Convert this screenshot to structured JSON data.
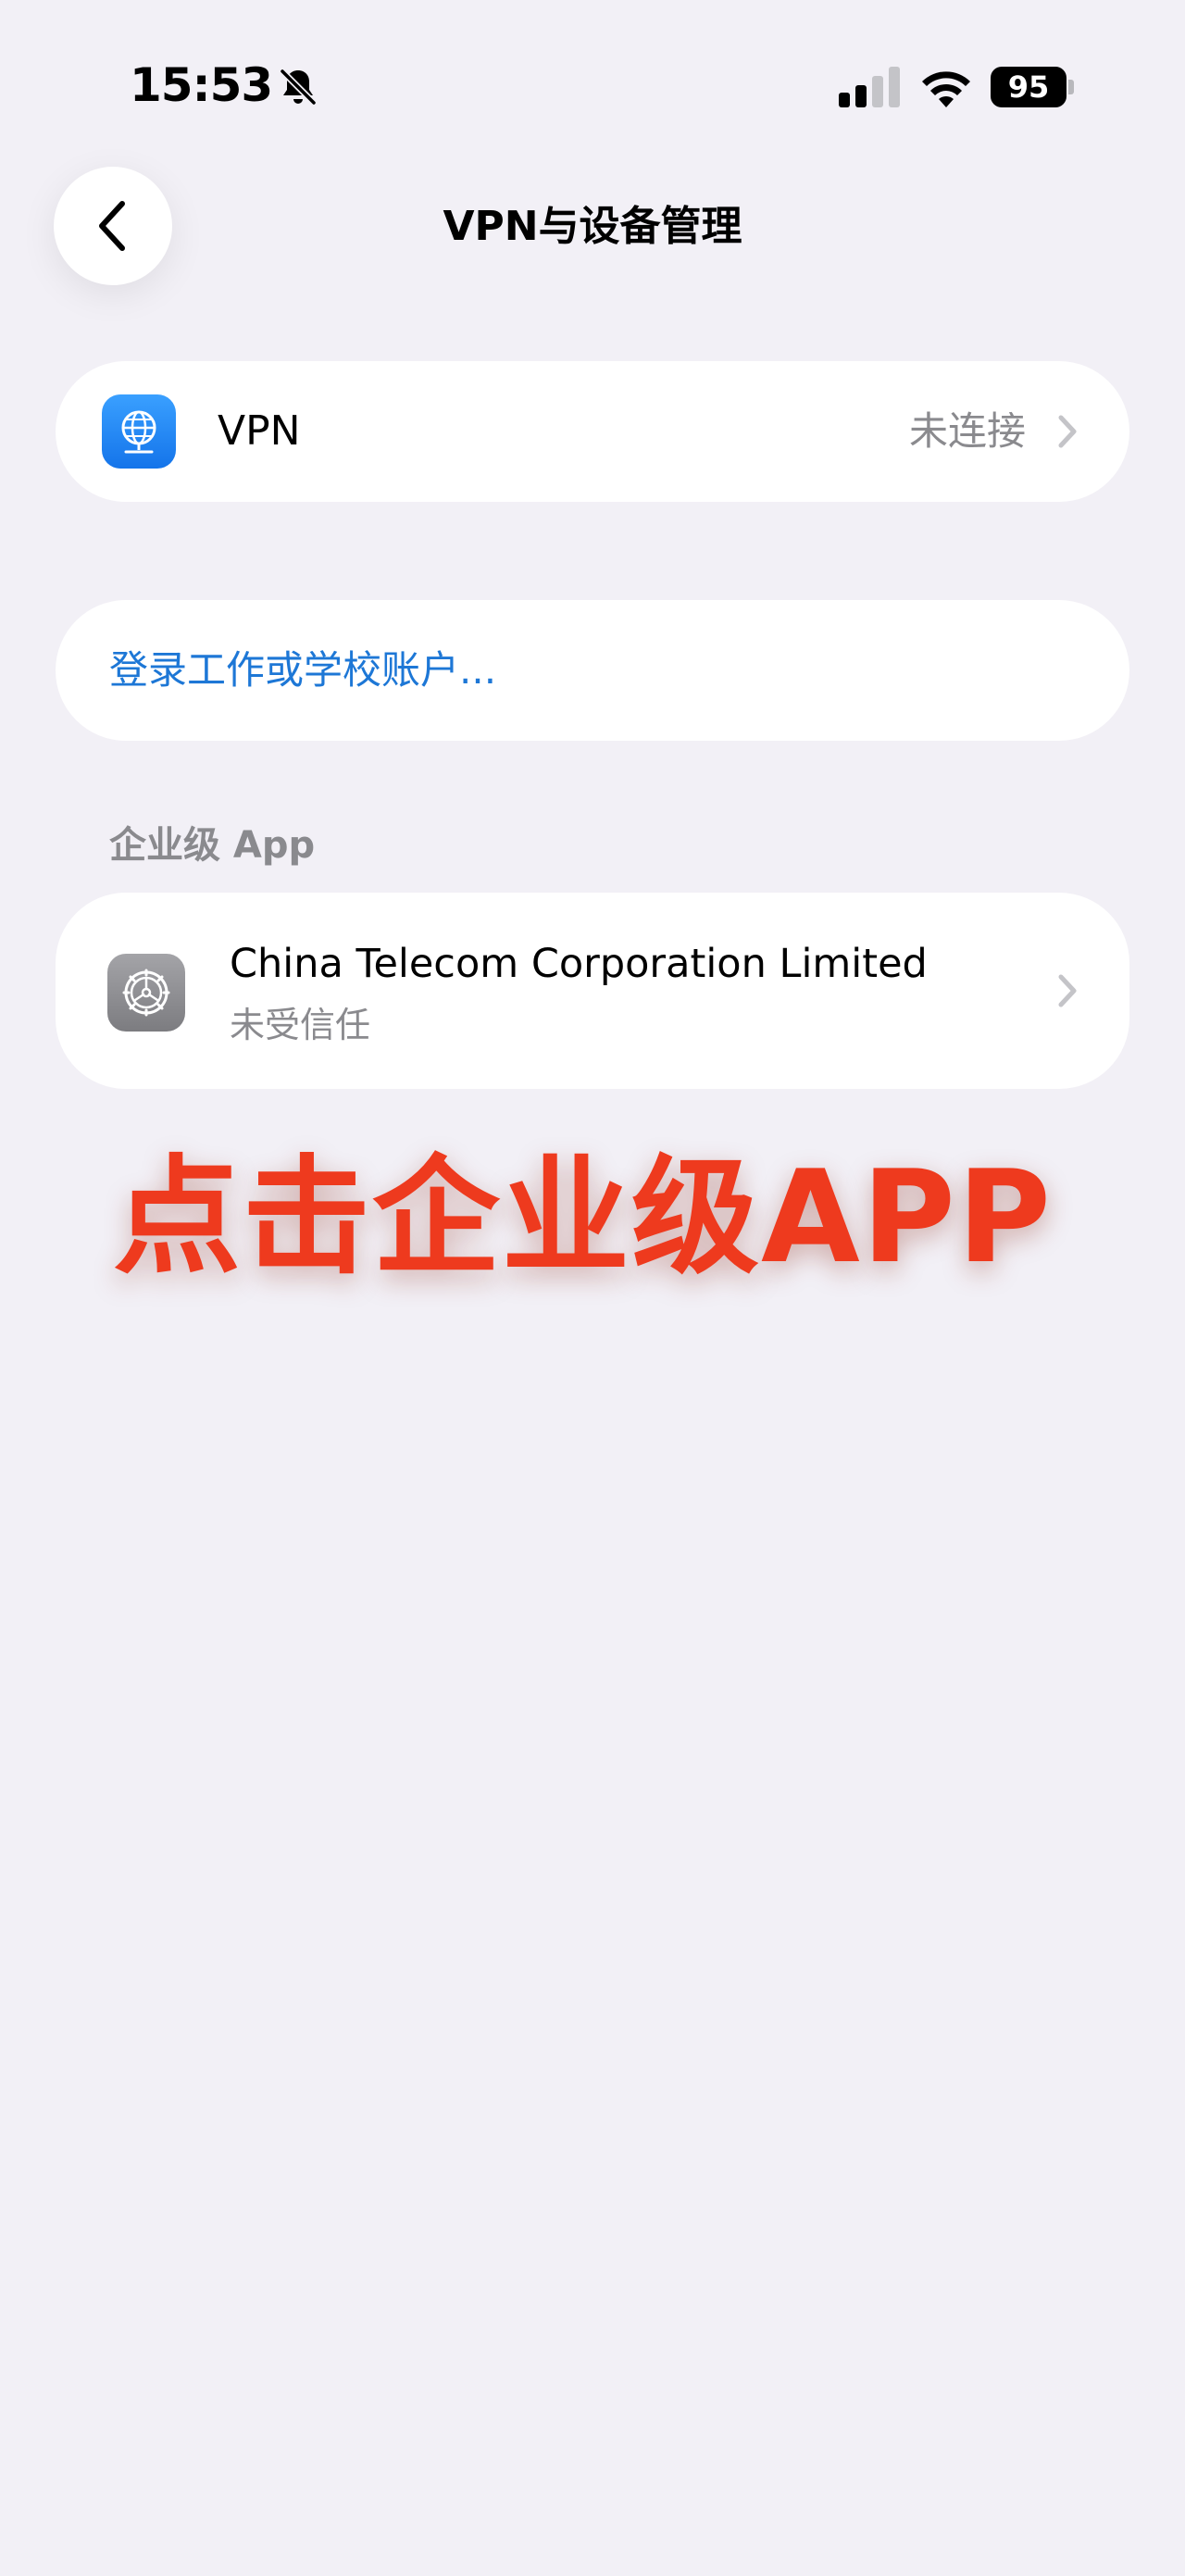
{
  "status_bar": {
    "time": "15:53",
    "battery": "95",
    "icons": [
      "bell-slash-icon",
      "cellular-signal-icon",
      "wifi-icon",
      "battery-icon"
    ]
  },
  "nav": {
    "back_icon": "chevron-left-icon",
    "title": "VPN与设备管理"
  },
  "vpn_row": {
    "icon": "globe-network-icon",
    "label": "VPN",
    "status": "未连接"
  },
  "login_row": {
    "label": "登录工作或学校账户..."
  },
  "enterprise_section": {
    "header": "企业级 App",
    "items": [
      {
        "icon": "settings-gear-icon",
        "name": "China Telecom Corporation Limited",
        "subtitle": "未受信任"
      }
    ]
  },
  "annotation": {
    "text": "点击企业级APP",
    "color": "#ee3a1e"
  },
  "colors": {
    "background": "#f2f0f6",
    "card": "#ffffff",
    "link_blue": "#1d77d6",
    "secondary_text": "#8a8a8e",
    "vpn_icon_blue": "#1474ea"
  }
}
